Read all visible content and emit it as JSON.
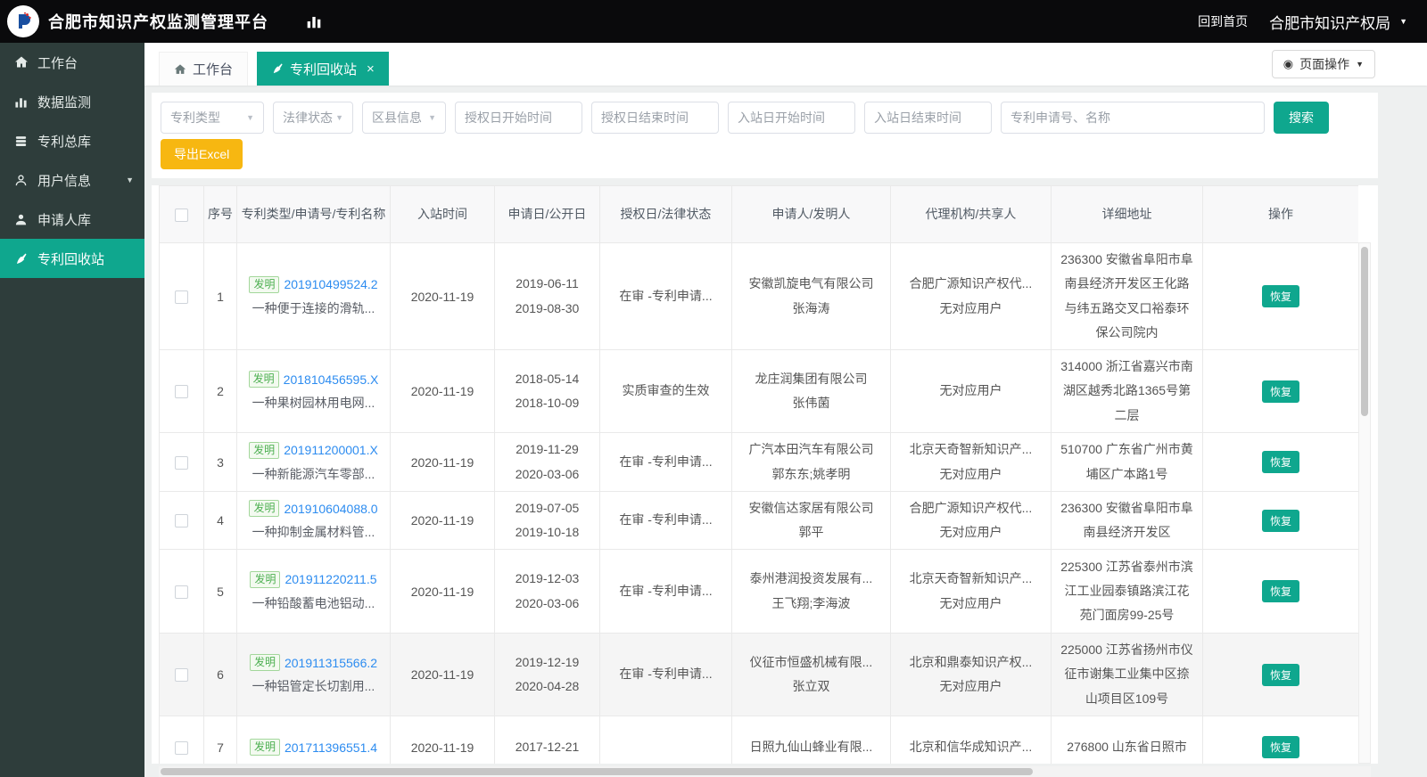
{
  "colors": {
    "accent_teal": "#0fa78e",
    "export_amber": "#f7b711",
    "link_blue": "#2d8cf0",
    "badge_green": "#4caf50",
    "header_bg": "#0a0a0c",
    "sidebar_bg": "#2e3d3b"
  },
  "header": {
    "title": "合肥市知识产权监测管理平台",
    "home_link": "回到首页",
    "org": "合肥市知识产权局"
  },
  "sidebar": {
    "items": [
      {
        "label": "工作台",
        "icon": "home-icon"
      },
      {
        "label": "数据监测",
        "icon": "bar-chart-icon"
      },
      {
        "label": "专利总库",
        "icon": "layers-icon"
      },
      {
        "label": "用户信息",
        "icon": "user-icon"
      },
      {
        "label": "申请人库",
        "icon": "person-icon"
      },
      {
        "label": "专利回收站",
        "icon": "broom-icon"
      }
    ]
  },
  "tabs": {
    "workbench": "工作台",
    "recycle": "专利回收站",
    "page_actions": "页面操作"
  },
  "filters": {
    "patent_type": "专利类型",
    "legal_status": "法律状态",
    "district": "区县信息",
    "auth_start": "授权日开始时间",
    "auth_end": "授权日结束时间",
    "entry_start": "入站日开始时间",
    "entry_end": "入站日结束时间",
    "keyword_placeholder": "专利申请号、名称",
    "search": "搜索",
    "export_excel": "导出Excel"
  },
  "table": {
    "columns": [
      "序号",
      "专利类型/申请号/专利名称",
      "入站时间",
      "申请日/公开日",
      "授权日/法律状态",
      "申请人/发明人",
      "代理机构/共享人",
      "详细地址",
      "操作"
    ],
    "action_label": "恢复",
    "rows": [
      {
        "no": "1",
        "type": "发明",
        "patent_no": "201910499524.2",
        "patent_name": "一种便于连接的滑轨...",
        "entry_date": "2020-11-19",
        "apply_date": "2019-06-11",
        "publish_date": "2019-08-30",
        "status": "在审 -专利申请...",
        "applicant": "安徽凯旋电气有限公司",
        "inventor": "张海涛",
        "agency": "合肥广源知识产权代...",
        "sharer": "无对应用户",
        "address": "236300 安徽省阜阳市阜南县经济开发区王化路与纬五路交叉口裕泰环保公司院内"
      },
      {
        "no": "2",
        "type": "发明",
        "patent_no": "201810456595.X",
        "patent_name": "一种果树园林用电网...",
        "entry_date": "2020-11-19",
        "apply_date": "2018-05-14",
        "publish_date": "2018-10-09",
        "status": "实质审查的生效",
        "applicant": "龙庄润集团有限公司",
        "inventor": "张伟菌",
        "agency": "",
        "sharer": "无对应用户",
        "address": "314000 浙江省嘉兴市南湖区越秀北路1365号第二层"
      },
      {
        "no": "3",
        "type": "发明",
        "patent_no": "201911200001.X",
        "patent_name": "一种新能源汽车零部...",
        "entry_date": "2020-11-19",
        "apply_date": "2019-11-29",
        "publish_date": "2020-03-06",
        "status": "在审 -专利申请...",
        "applicant": "广汽本田汽车有限公司",
        "inventor": "郭东东;姚孝明",
        "agency": "北京天奇智新知识产...",
        "sharer": "无对应用户",
        "address": "510700 广东省广州市黄埔区广本路1号"
      },
      {
        "no": "4",
        "type": "发明",
        "patent_no": "201910604088.0",
        "patent_name": "一种抑制金属材料管...",
        "entry_date": "2020-11-19",
        "apply_date": "2019-07-05",
        "publish_date": "2019-10-18",
        "status": "在审 -专利申请...",
        "applicant": "安徽信达家居有限公司",
        "inventor": "郭平",
        "agency": "合肥广源知识产权代...",
        "sharer": "无对应用户",
        "address": "236300 安徽省阜阳市阜南县经济开发区"
      },
      {
        "no": "5",
        "type": "发明",
        "patent_no": "201911220211.5",
        "patent_name": "一种铅酸蓄电池铝动...",
        "entry_date": "2020-11-19",
        "apply_date": "2019-12-03",
        "publish_date": "2020-03-06",
        "status": "在审 -专利申请...",
        "applicant": "泰州港润投资发展有...",
        "inventor": "王飞翔;李海波",
        "agency": "北京天奇智新知识产...",
        "sharer": "无对应用户",
        "address": "225300 江苏省泰州市滨江工业园泰镇路滨江花苑门面房99-25号"
      },
      {
        "no": "6",
        "type": "发明",
        "patent_no": "201911315566.2",
        "patent_name": "一种铝管定长切割用...",
        "entry_date": "2020-11-19",
        "apply_date": "2019-12-19",
        "publish_date": "2020-04-28",
        "status": "在审 -专利申请...",
        "applicant": "仪征市恒盛机械有限...",
        "inventor": "张立双",
        "agency": "北京和鼎泰知识产权...",
        "sharer": "无对应用户",
        "address": "225000 江苏省扬州市仪征市谢集工业集中区捺山项目区109号",
        "highlight": true
      },
      {
        "no": "7",
        "type": "发明",
        "patent_no": "201711396551.4",
        "patent_name": "",
        "entry_date": "2020-11-19",
        "apply_date": "2017-12-21",
        "publish_date": "",
        "status": "",
        "applicant": "日照九仙山蜂业有限...",
        "inventor": "",
        "agency": "北京和信华成知识产...",
        "sharer": "",
        "address": "276800 山东省日照市"
      }
    ]
  }
}
